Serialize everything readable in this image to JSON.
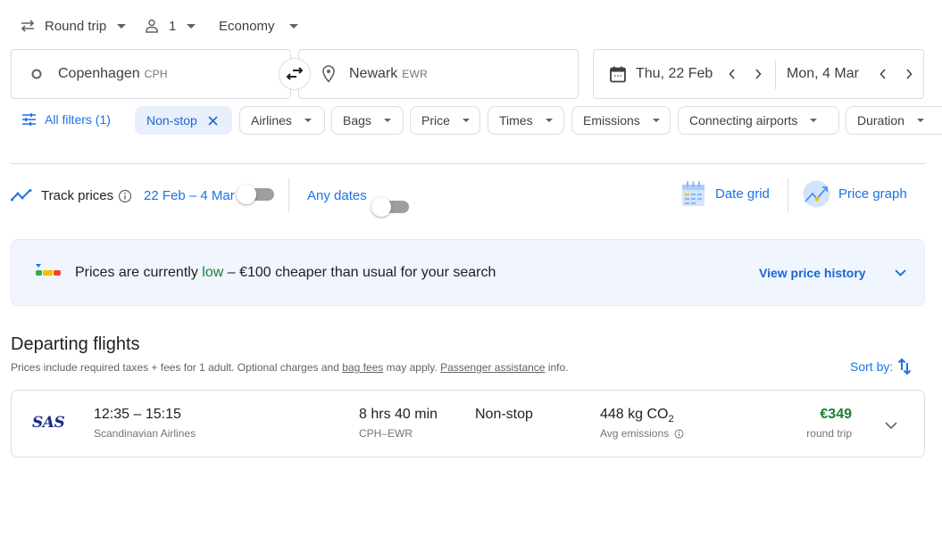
{
  "trip_options": {
    "trip_type": "Round trip",
    "passengers": "1",
    "cabin_class": "Economy"
  },
  "search": {
    "origin": {
      "city": "Copenhagen",
      "code": "CPH"
    },
    "destination": {
      "city": "Newark",
      "code": "EWR"
    },
    "depart_date": "Thu, 22 Feb",
    "return_date": "Mon, 4 Mar"
  },
  "filters": {
    "all_filters_label": "All filters (1)",
    "active_chip": "Non-stop",
    "chips": [
      "Airlines",
      "Bags",
      "Price",
      "Times",
      "Emissions",
      "Connecting airports",
      "Duration"
    ]
  },
  "tracking": {
    "track_label": "Track prices",
    "date_range": "22 Feb – 4 Mar",
    "track_enabled": false,
    "any_dates_label": "Any dates",
    "any_dates_enabled": false,
    "date_grid_label": "Date grid",
    "price_graph_label": "Price graph"
  },
  "price_insight": {
    "prefix": "Prices are currently ",
    "level": "low",
    "suffix": " – €100 cheaper than usual for your search",
    "history_link": "View price history",
    "level_color": "#188038"
  },
  "results": {
    "heading": "Departing flights",
    "note_part1": "Prices include required taxes + fees for 1 adult. Optional charges and ",
    "bag_fees_link": "bag fees",
    "note_part2": " may apply. ",
    "assistance_link": "Passenger assistance",
    "note_part3": " info.",
    "sort_label": "Sort by:",
    "flights": [
      {
        "airline_logo": "SAS",
        "times": "12:35 – 15:15",
        "airline": "Scandinavian Airlines",
        "duration": "8 hrs 40 min",
        "route": "CPH–EWR",
        "stops": "Non-stop",
        "emissions_value": "448 kg CO",
        "emissions_sub": "2",
        "emissions_label": "Avg emissions",
        "price": "€349",
        "price_type": "round trip",
        "price_color": "#188038"
      }
    ]
  },
  "colors": {
    "accent": "#1a73e8",
    "chip_active_bg": "#e8f0fe",
    "banner_bg": "#f0f5fe"
  }
}
